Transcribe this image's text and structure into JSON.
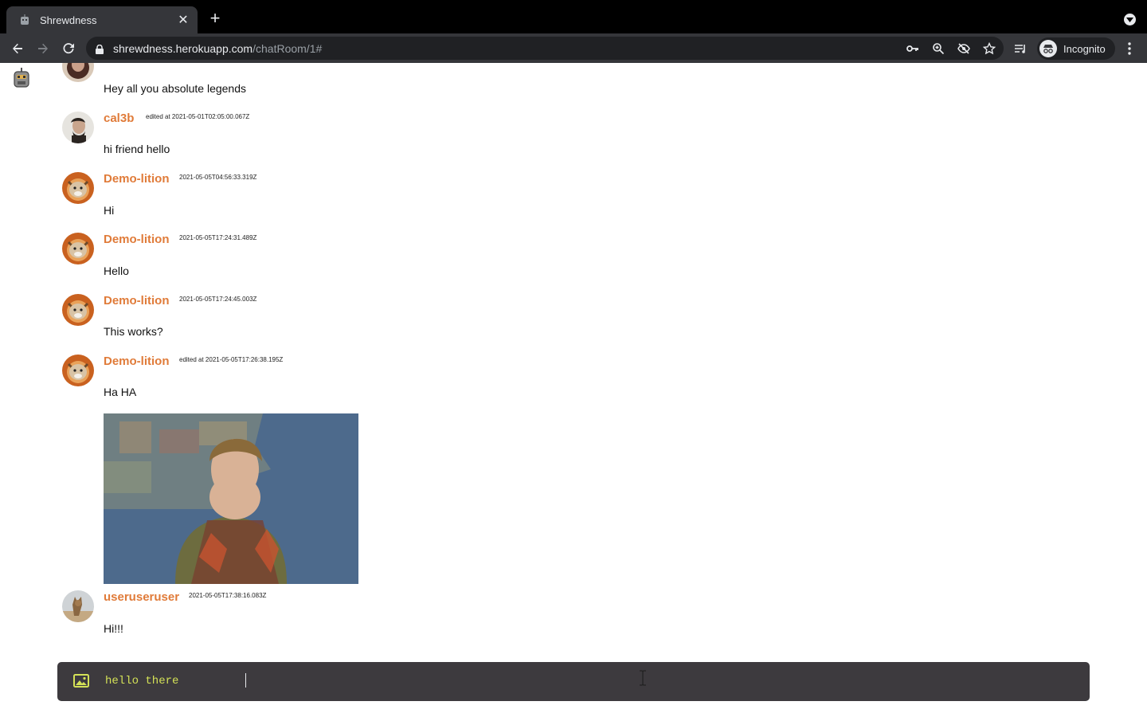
{
  "browser": {
    "tab_title": "Shrewdness",
    "tab_close": "✕",
    "new_tab": "+",
    "url_host": "shrewdness.herokuapp.com",
    "url_path": "/chatRoom/1#",
    "incognito_label": "Incognito",
    "icons": [
      "back-icon",
      "forward-icon",
      "reload-icon",
      "lock-icon",
      "key-icon",
      "zoom-icon",
      "eye-off-icon",
      "star-icon",
      "media-queue-icon",
      "incognito-icon",
      "menu-icon"
    ]
  },
  "chat": {
    "messages": [
      {
        "username": "",
        "timestamp": "",
        "text": "Hey all you absolute legends"
      },
      {
        "username": "cal3b",
        "timestamp": "edited at 2021-05-01T02:05:00.067Z",
        "text": "hi friend hello"
      },
      {
        "username": "Demo-lition",
        "timestamp": "2021-05-05T04:56:33.319Z",
        "text": "Hi"
      },
      {
        "username": "Demo-lition",
        "timestamp": "2021-05-05T17:24:31.489Z",
        "text": "Hello"
      },
      {
        "username": "Demo-lition",
        "timestamp": "2021-05-05T17:24:45.003Z",
        "text": "This works?"
      },
      {
        "username": "Demo-lition",
        "timestamp": "edited at 2021-05-05T17:26:38.195Z",
        "text": "Ha HA"
      },
      {
        "username": "useruseruser",
        "timestamp": "2021-05-05T17:38:16.083Z",
        "text": "Hi!!!"
      }
    ]
  },
  "composer": {
    "value": "hello there "
  },
  "colors": {
    "username": "#e07b39",
    "composer_bg": "#3d3a3e",
    "composer_text": "#d4e157"
  }
}
